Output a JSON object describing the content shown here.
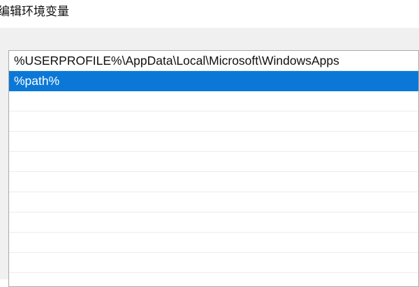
{
  "window": {
    "title": "编辑环境变量"
  },
  "path_list": {
    "entries": [
      {
        "text": "%USERPROFILE%\\AppData\\Local\\Microsoft\\WindowsApps",
        "selected": false
      },
      {
        "text": "%path%",
        "selected": true
      },
      {
        "text": "",
        "selected": false
      },
      {
        "text": "",
        "selected": false
      },
      {
        "text": "",
        "selected": false
      },
      {
        "text": "",
        "selected": false
      },
      {
        "text": "",
        "selected": false
      },
      {
        "text": "",
        "selected": false
      },
      {
        "text": "",
        "selected": false
      },
      {
        "text": "",
        "selected": false
      },
      {
        "text": "",
        "selected": false
      },
      {
        "text": "",
        "selected": false
      }
    ],
    "selection_color": "#0b78d7"
  }
}
